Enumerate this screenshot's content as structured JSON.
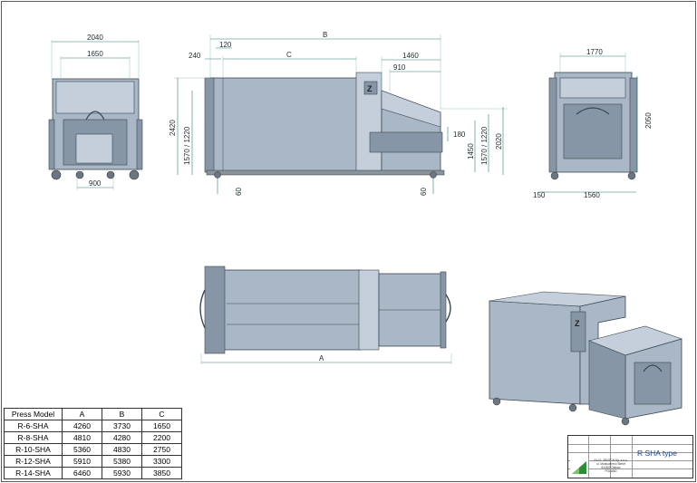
{
  "title_block": {
    "title": "R SHA type",
    "company_lines": [
      "P.U.S. ZENTCH Sp. z o.o.",
      "ul. Mostowierno Street",
      "63-800 Ostrów",
      "POLAND"
    ]
  },
  "dimensions": {
    "front_overall_width": "2040",
    "front_inner_width": "1650",
    "front_bottom_width": "900",
    "side_total_length": "B",
    "side_offset_120": "120",
    "side_offset_240": "240",
    "side_container_length": "C",
    "side_hopper_length": "1460",
    "side_hopper_opening": "910",
    "side_total_height": "2420",
    "side_container_height": "1570 / 1220",
    "side_hopper_height": "1450",
    "side_loading_height": "1570 / 1220",
    "side_rear_height": "2020",
    "side_hopper_lip": "180",
    "side_wheel_left": "60",
    "side_wheel_right": "60",
    "rear_top_width": "1770",
    "rear_height": "2050",
    "rear_bottom_width": "1560",
    "rear_offset": "150",
    "top_overall_length": "A"
  },
  "spec_table": {
    "headers": [
      "Press Model",
      "A",
      "B",
      "C"
    ],
    "rows": [
      [
        "R-6-SHA",
        "4260",
        "3730",
        "1650"
      ],
      [
        "R-8-SHA",
        "4810",
        "4280",
        "2200"
      ],
      [
        "R-10-SHA",
        "5360",
        "4830",
        "2750"
      ],
      [
        "R-12-SHA",
        "5910",
        "5380",
        "3300"
      ],
      [
        "R-14-SHA",
        "6460",
        "5930",
        "3850"
      ]
    ]
  },
  "colors": {
    "machine_body": "#a9b7c6",
    "dimension_lines": "#2e7d74",
    "title_text": "#1e4a8a",
    "logo": "#2e8b3a"
  },
  "labels": {
    "badge_letter": "Z"
  }
}
